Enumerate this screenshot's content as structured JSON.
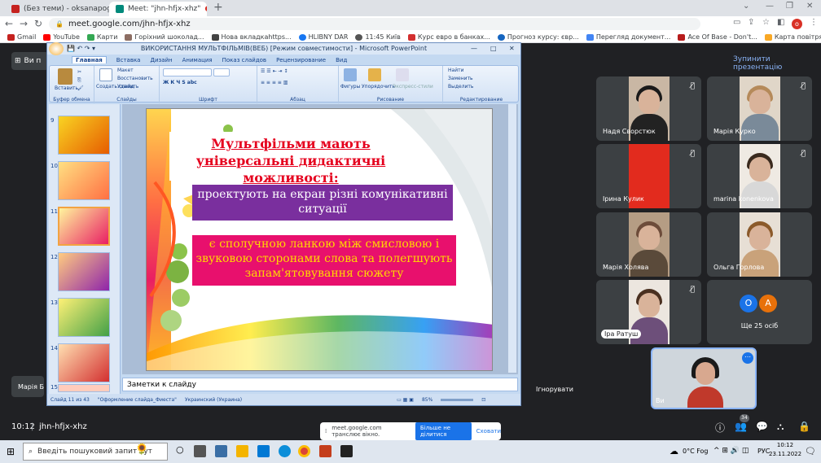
{
  "browser": {
    "tabs": [
      {
        "title": "(Без теми) - oksanapogorelko@..."
      },
      {
        "title": "Meet: \"jhn-hfjx-xhz\""
      }
    ],
    "new_tab": "+",
    "url": "meet.google.com/jhn-hfjx-xhz",
    "bookmarks": [
      "Gmail",
      "YouTube",
      "Карти",
      "Горіхний шоколад...",
      "Нова вкладкаhttps...",
      "HLIBNY DAR",
      "11:45 Київ",
      "Курс евро в банках...",
      "Прогноз курсу: євр...",
      "Перегляд документ...",
      "Ace Of Base - Don't...",
      "Карта повітряних т..."
    ]
  },
  "meet": {
    "presenting_label": "Ви п",
    "stop_presenting": "Зупинити презентацію",
    "participants": [
      {
        "name": "Надя Сворстюк"
      },
      {
        "name": "Марія Курко"
      },
      {
        "name": "Ірина Кулик"
      },
      {
        "name": "marina konenkova"
      },
      {
        "name": "Марія Холява"
      },
      {
        "name": "Ольга Горлова"
      },
      {
        "name": "Іра Ратуш"
      }
    ],
    "others_avatars": [
      "O",
      "A"
    ],
    "others_count": "Ще 25 осіб",
    "self_label": "Ви",
    "left_name": "Марія Бар",
    "ignore": "Ігнорувати",
    "meeting_time": "10:12",
    "meeting_code": "jhn-hfjx-xhz",
    "people_badge": "34",
    "share_notice": "meet.google.com транслює вікно.",
    "stop_sharing": "Більше не ділитися",
    "hide": "Сховати"
  },
  "ppt": {
    "window_title": "ВИКОРИСТАННЯ МУЛЬТФІЛЬМІВ(ВЕБ) [Режим совместимости] - Microsoft PowerPoint",
    "ribbon_tabs": [
      "Главная",
      "Вставка",
      "Дизайн",
      "Анимация",
      "Показ слайдов",
      "Рецензирование",
      "Вид"
    ],
    "groups": [
      "Буфер обмена",
      "Слайды",
      "Шрифт",
      "Абзац",
      "Рисование",
      "Редактирование"
    ],
    "buttons": {
      "paste": "Вставить",
      "create_slide": "Создать слайд",
      "layout": "Макет",
      "restore": "Восстановить",
      "delete": "Удалить",
      "shapes": "Фигуры",
      "arrange": "Упорядочить",
      "quick_styles": "Экспресс-стили",
      "find": "Найти",
      "replace": "Заменить",
      "select": "Выделить"
    },
    "thumb_numbers": [
      "9",
      "10",
      "11",
      "12",
      "13",
      "14",
      "15"
    ],
    "notes_placeholder": "Заметки к слайду",
    "status": {
      "slide": "Слайд 11 из 43",
      "theme": "\"Оформление слайда_Фиеста\"",
      "language": "Украинский (Украина)",
      "zoom": "85%"
    },
    "slide": {
      "title": "Мультфільми мають універсальні дидактичні можливості:",
      "box1": "проектують на екран різні комунікативні ситуації",
      "box2": "є сполучною ланкою між смисловою і звуковою сторонами слова та полегшують запам'ятовування сюжету"
    }
  },
  "taskbar": {
    "search_placeholder": "Введіть пошуковий запит тут",
    "weather": "0°C Fog",
    "lang": "РУС",
    "time": "10:12",
    "date": "23.11.2022"
  },
  "colors": {
    "meet_bg": "#202124",
    "tile_bg": "#3c4043",
    "title_red": "#e5001e",
    "box1_purple": "#7a2f9e",
    "box2_pink": "#e8106d",
    "box2_text": "#ffd700"
  }
}
